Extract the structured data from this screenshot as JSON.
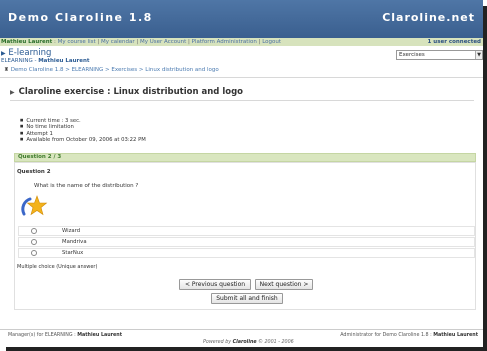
{
  "header": {
    "campus_name": "Demo Claroline 1.8",
    "site_name": "Claroline.net"
  },
  "userbar": {
    "user_name": "Mathieu Laurent",
    "links": [
      "My course list",
      "My calendar",
      "My User Account",
      "Platform Administration",
      "Logout"
    ],
    "connected": "1 user connected"
  },
  "course": {
    "title": "E-learning",
    "code": "ELEARNING",
    "code_sep": " - ",
    "teacher": "Mathieu Laurent",
    "tool_select": "Exercises"
  },
  "breadcrumb": {
    "items": [
      "Demo Claroline 1.8",
      "ELEARNING",
      "Exercises",
      "Linux distribution and logo"
    ],
    "sep": " > "
  },
  "exercise": {
    "title": "Claroline exercise : Linux distribution and logo",
    "info": [
      "Current time : 3 sec.",
      "No time limitation",
      "Attempt 1",
      "Available from October 09, 2006 at 03:22 PM"
    ]
  },
  "question": {
    "counter": "Question 2 / 3",
    "name": "Question 2",
    "text": "What is the name of the distribution ?",
    "answers": [
      "Wizard",
      "Mandriva",
      "StarNux"
    ],
    "type_note": "Multiple choice (Unique answer)"
  },
  "buttons": {
    "previous": "< Previous question",
    "next": "Next question >",
    "submit": "Submit all and finish"
  },
  "footer": {
    "managers_label": "Manager(s) for ELEARNING : ",
    "managers_name": "Mathieu Laurent",
    "admin_label": "Administrator for Demo Claroline 1.8 : ",
    "admin_name": "Mathieu Laurent",
    "powered_label": "Powered by ",
    "powered_brand": "Claroline",
    "powered_years": " © 2001 - 2006"
  },
  "colors": {
    "header": "#4a70a0",
    "userbar": "#d7e3bd",
    "question_bar": "#d9e6bf",
    "link": "#4a7ab0"
  }
}
